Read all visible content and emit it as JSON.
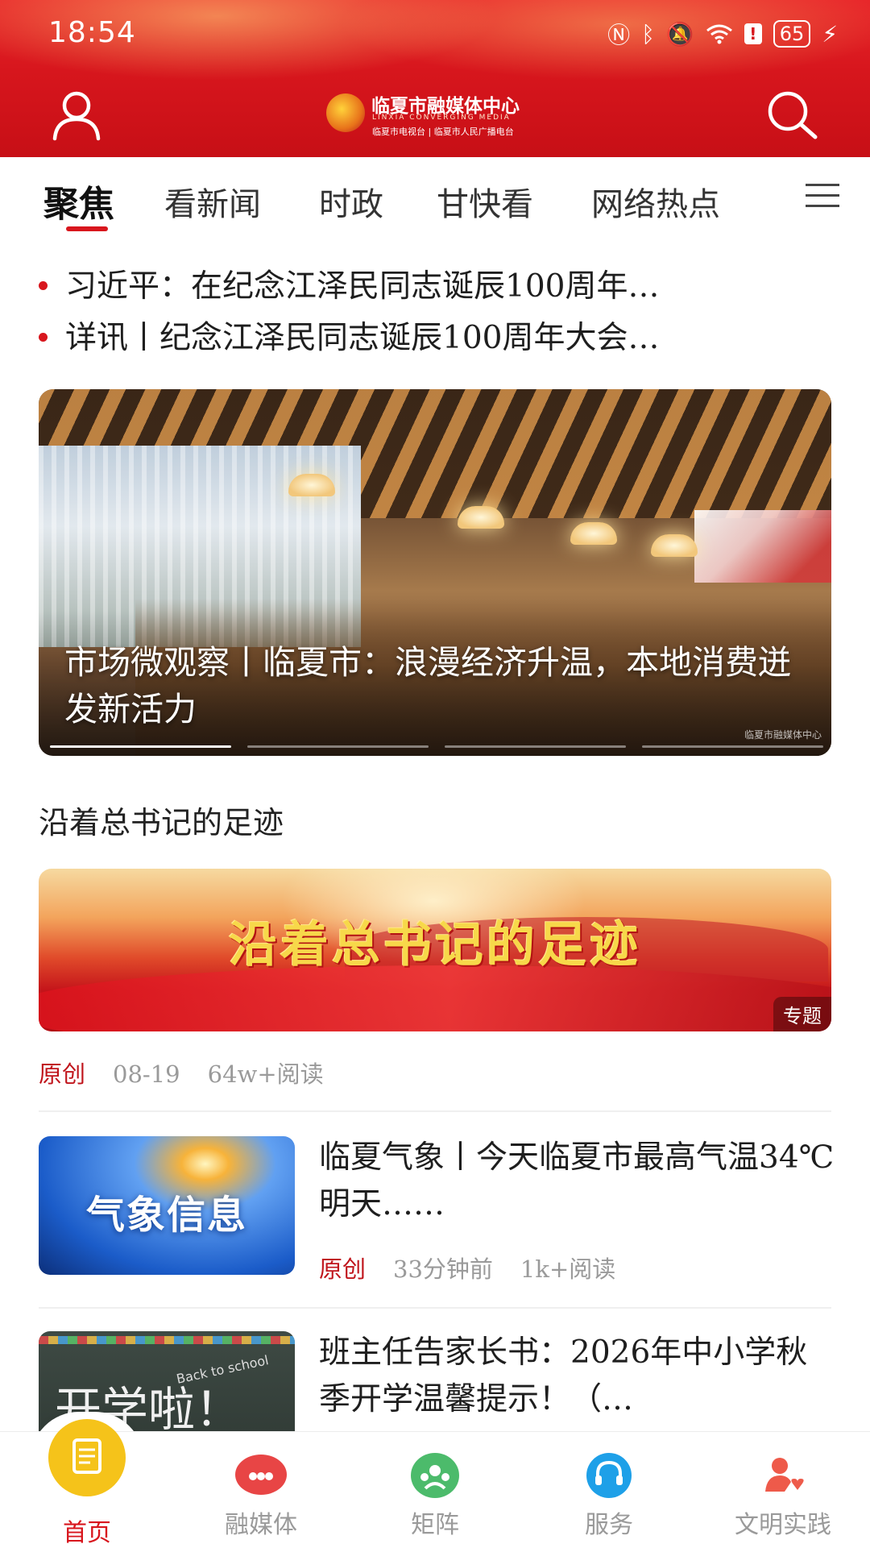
{
  "status_bar": {
    "time": "18:54",
    "battery": "65"
  },
  "header": {
    "logo_name": "临夏市融媒体中心",
    "logo_en": "LINXIA CONVERGING MEDIA",
    "logo_sub": "临夏市电视台 | 临夏市人民广播电台",
    "brand_color": "#d8161d"
  },
  "tabs": [
    {
      "label": "聚焦",
      "active": true
    },
    {
      "label": "看新闻"
    },
    {
      "label": "时政"
    },
    {
      "label": "甘快看"
    },
    {
      "label": "网络热点"
    }
  ],
  "headlines": [
    "习近平：在纪念江泽民同志诞辰100周年…",
    "详讯丨纪念江泽民同志诞辰100周年大会…"
  ],
  "carousel": {
    "caption": "市场微观察丨临夏市：浪漫经济升温，本地消费迸发新活力",
    "watermark": "临夏市融媒体中心",
    "active_index": 0,
    "count": 4
  },
  "section": {
    "title": "沿着总书记的足迹",
    "banner_text": "沿着总书记的足迹",
    "badge": "专题",
    "meta": {
      "tag": "原创",
      "date": "08-19",
      "reads": "64w+阅读"
    }
  },
  "news": [
    {
      "title": "临夏气象丨今天临夏市最高气温34℃ 明天……",
      "thumb_text": "气象信息",
      "tag": "原创",
      "time": "33分钟前",
      "reads": "1k+阅读"
    },
    {
      "title": "班主任告家长书：2026年中小学秋季开学温馨提示！（…",
      "thumb_text": "开学啦！",
      "thumb_small": "Back to school"
    }
  ],
  "bottom_nav": [
    {
      "label": "首页",
      "icon": "home-doc-icon",
      "color": "#f5c31a",
      "active": true
    },
    {
      "label": "融媒体",
      "icon": "media-icon",
      "color": "#e84545"
    },
    {
      "label": "矩阵",
      "icon": "matrix-icon",
      "color": "#4cbb6b"
    },
    {
      "label": "服务",
      "icon": "headset-icon",
      "color": "#1ea0e8"
    },
    {
      "label": "文明实践",
      "icon": "volunteer-icon",
      "color": "#ee5a4a"
    }
  ]
}
